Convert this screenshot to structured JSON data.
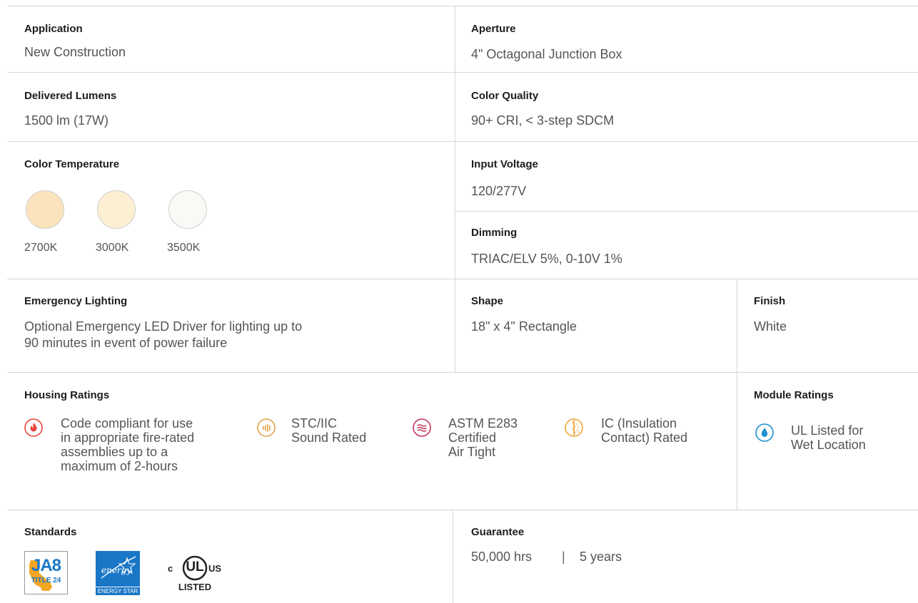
{
  "application": {
    "label": "Application",
    "value": "New Construction"
  },
  "aperture": {
    "label": "Aperture",
    "value": "4\" Octagonal Junction Box"
  },
  "delivered_lumens": {
    "label": "Delivered Lumens",
    "value": "1500 lm (17W)"
  },
  "color_quality": {
    "label": "Color Quality",
    "value": "90+ CRI, < 3-step SDCM"
  },
  "color_temperature": {
    "label": "Color Temperature",
    "swatches": [
      {
        "label": "2700K",
        "color": "#fbe3bb"
      },
      {
        "label": "3000K",
        "color": "#fcefd2"
      },
      {
        "label": "3500K",
        "color": "#fbf9f6"
      }
    ]
  },
  "input_voltage": {
    "label": "Input Voltage",
    "value": "120/277V"
  },
  "dimming": {
    "label": "Dimming",
    "value": "TRIAC/ELV 5%, 0-10V 1%"
  },
  "emergency_lighting": {
    "label": "Emergency Lighting",
    "value_line1": "Optional Emergency LED Driver for lighting up to",
    "value_line2": "90 minutes in event of power failure"
  },
  "shape": {
    "label": "Shape",
    "value": "18\" x 4\" Rectangle"
  },
  "finish": {
    "label": "Finish",
    "value": "White"
  },
  "housing_ratings": {
    "label": "Housing Ratings",
    "items": [
      {
        "icon": "flame-icon",
        "color": "#e8453c",
        "text": "Code compliant for use\nin appropriate fire-rated\nassemblies up to a\nmaximum of 2-hours"
      },
      {
        "icon": "sound-icon",
        "color": "#e0a24a",
        "text": "STC/IIC\nSound Rated"
      },
      {
        "icon": "air-icon",
        "color": "#c1365b",
        "text": "ASTM E283\nCertified\nAir Tight"
      },
      {
        "icon": "insulation-icon",
        "color": "#f0a53a",
        "text": "IC (Insulation\nContact) Rated"
      }
    ]
  },
  "module_ratings": {
    "label": "Module Ratings",
    "items": [
      {
        "icon": "water-drop-icon",
        "color": "#1d8fd1",
        "text": "UL Listed for\nWet Location"
      }
    ]
  },
  "standards": {
    "label": "Standards",
    "badges": [
      {
        "name": "ja8-badge",
        "main": "JA8",
        "sub": "TITLE 24",
        "color": "#f5a623",
        "accent": "#1a76c6"
      },
      {
        "name": "energy-star-badge",
        "main": "energy",
        "sub": "ENERGY STAR",
        "color": "#1a76c6"
      },
      {
        "name": "ul-listed-badge",
        "main": "UL",
        "left": "c",
        "right": "US",
        "sub": "LISTED",
        "color": "#222222"
      }
    ]
  },
  "guarantee": {
    "label": "Guarantee",
    "hours": "50,000 hrs",
    "separator": "|",
    "years": "5 years"
  }
}
